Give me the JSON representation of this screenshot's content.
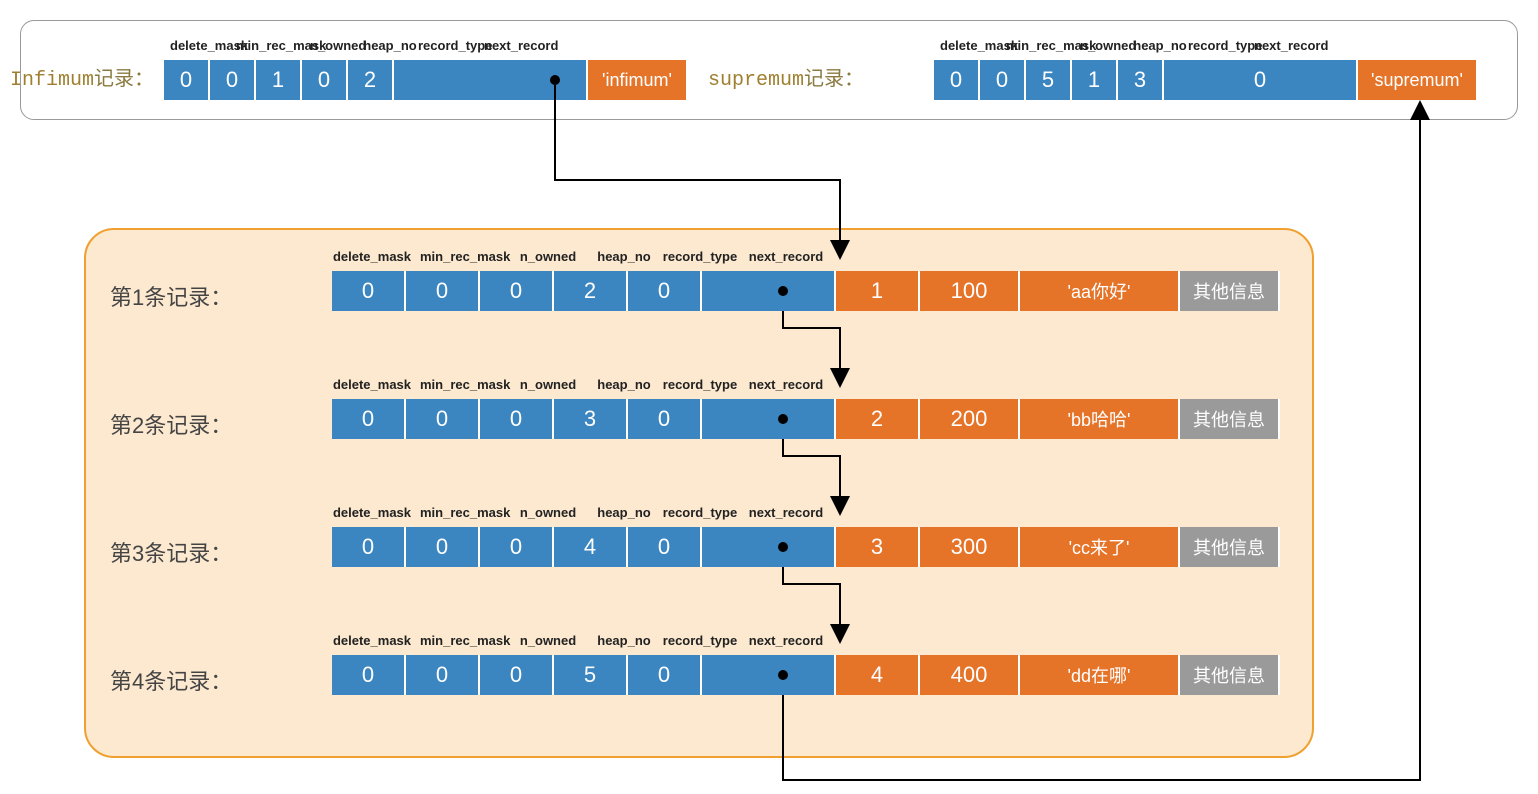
{
  "header_cols": [
    "delete_mask",
    "min_rec_mask",
    "n_owned",
    "heap_no",
    "record_type",
    "next_record"
  ],
  "infimum": {
    "label_prefix": "Infimum",
    "label_suffix": "记录：",
    "header_values": [
      "0",
      "0",
      "1",
      "0",
      "2",
      ""
    ],
    "tail": "'infimum'"
  },
  "supremum": {
    "label_prefix": "supremum",
    "label_suffix": "记录：",
    "header_values": [
      "0",
      "0",
      "5",
      "1",
      "3",
      "0"
    ],
    "tail": "'supremum'"
  },
  "rows": [
    {
      "label": "第1条记录：",
      "header_values": [
        "0",
        "0",
        "0",
        "2",
        "0",
        ""
      ],
      "data": [
        "1",
        "100",
        "'aa你好'"
      ],
      "other": "其他信息"
    },
    {
      "label": "第2条记录：",
      "header_values": [
        "0",
        "0",
        "0",
        "3",
        "0",
        ""
      ],
      "data": [
        "2",
        "200",
        "'bb哈哈'"
      ],
      "other": "其他信息"
    },
    {
      "label": "第3条记录：",
      "header_values": [
        "0",
        "0",
        "0",
        "4",
        "0",
        ""
      ],
      "data": [
        "3",
        "300",
        "'cc来了'"
      ],
      "other": "其他信息"
    },
    {
      "label": "第4条记录：",
      "header_values": [
        "0",
        "0",
        "0",
        "5",
        "0",
        ""
      ],
      "data": [
        "4",
        "400",
        "'dd在哪'"
      ],
      "other": "其他信息"
    }
  ],
  "colors": {
    "blue": "#3b85c0",
    "orange": "#e57328",
    "gray": "#9a9a9a"
  }
}
